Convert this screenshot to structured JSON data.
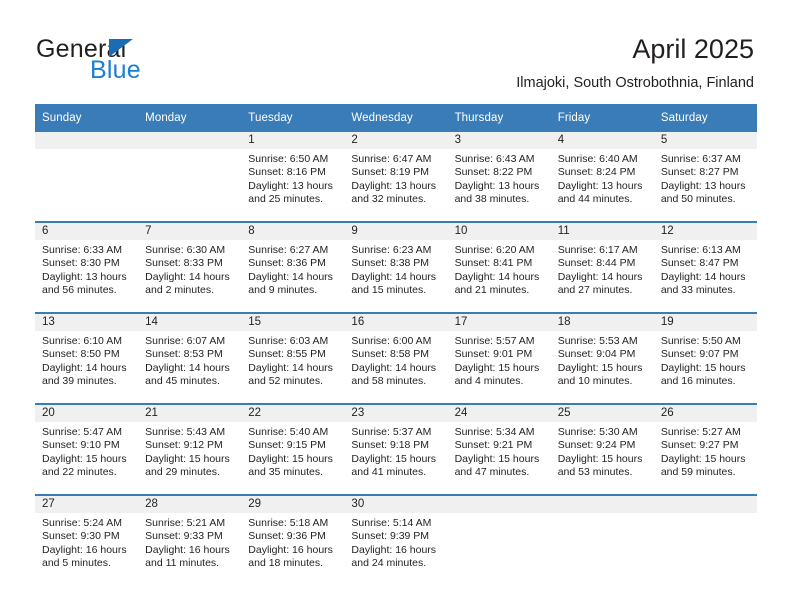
{
  "brand": {
    "name_top": "General",
    "name_bottom": "Blue",
    "accent_color": "#1b7fd4",
    "triangle_color": "#1b6cb5"
  },
  "header": {
    "title": "April 2025",
    "subtitle": "Ilmajoki, South Ostrobothnia, Finland"
  },
  "calendar": {
    "header_bg": "#3a7cb8",
    "daynum_bg": "#f0f0f0",
    "weekday_headers": [
      "Sunday",
      "Monday",
      "Tuesday",
      "Wednesday",
      "Thursday",
      "Friday",
      "Saturday"
    ],
    "weeks": [
      [
        {
          "day": "",
          "sunrise": "",
          "sunset": "",
          "daylight_line1": "",
          "daylight_line2": ""
        },
        {
          "day": "",
          "sunrise": "",
          "sunset": "",
          "daylight_line1": "",
          "daylight_line2": ""
        },
        {
          "day": "1",
          "sunrise": "Sunrise: 6:50 AM",
          "sunset": "Sunset: 8:16 PM",
          "daylight_line1": "Daylight: 13 hours",
          "daylight_line2": "and 25 minutes."
        },
        {
          "day": "2",
          "sunrise": "Sunrise: 6:47 AM",
          "sunset": "Sunset: 8:19 PM",
          "daylight_line1": "Daylight: 13 hours",
          "daylight_line2": "and 32 minutes."
        },
        {
          "day": "3",
          "sunrise": "Sunrise: 6:43 AM",
          "sunset": "Sunset: 8:22 PM",
          "daylight_line1": "Daylight: 13 hours",
          "daylight_line2": "and 38 minutes."
        },
        {
          "day": "4",
          "sunrise": "Sunrise: 6:40 AM",
          "sunset": "Sunset: 8:24 PM",
          "daylight_line1": "Daylight: 13 hours",
          "daylight_line2": "and 44 minutes."
        },
        {
          "day": "5",
          "sunrise": "Sunrise: 6:37 AM",
          "sunset": "Sunset: 8:27 PM",
          "daylight_line1": "Daylight: 13 hours",
          "daylight_line2": "and 50 minutes."
        }
      ],
      [
        {
          "day": "6",
          "sunrise": "Sunrise: 6:33 AM",
          "sunset": "Sunset: 8:30 PM",
          "daylight_line1": "Daylight: 13 hours",
          "daylight_line2": "and 56 minutes."
        },
        {
          "day": "7",
          "sunrise": "Sunrise: 6:30 AM",
          "sunset": "Sunset: 8:33 PM",
          "daylight_line1": "Daylight: 14 hours",
          "daylight_line2": "and 2 minutes."
        },
        {
          "day": "8",
          "sunrise": "Sunrise: 6:27 AM",
          "sunset": "Sunset: 8:36 PM",
          "daylight_line1": "Daylight: 14 hours",
          "daylight_line2": "and 9 minutes."
        },
        {
          "day": "9",
          "sunrise": "Sunrise: 6:23 AM",
          "sunset": "Sunset: 8:38 PM",
          "daylight_line1": "Daylight: 14 hours",
          "daylight_line2": "and 15 minutes."
        },
        {
          "day": "10",
          "sunrise": "Sunrise: 6:20 AM",
          "sunset": "Sunset: 8:41 PM",
          "daylight_line1": "Daylight: 14 hours",
          "daylight_line2": "and 21 minutes."
        },
        {
          "day": "11",
          "sunrise": "Sunrise: 6:17 AM",
          "sunset": "Sunset: 8:44 PM",
          "daylight_line1": "Daylight: 14 hours",
          "daylight_line2": "and 27 minutes."
        },
        {
          "day": "12",
          "sunrise": "Sunrise: 6:13 AM",
          "sunset": "Sunset: 8:47 PM",
          "daylight_line1": "Daylight: 14 hours",
          "daylight_line2": "and 33 minutes."
        }
      ],
      [
        {
          "day": "13",
          "sunrise": "Sunrise: 6:10 AM",
          "sunset": "Sunset: 8:50 PM",
          "daylight_line1": "Daylight: 14 hours",
          "daylight_line2": "and 39 minutes."
        },
        {
          "day": "14",
          "sunrise": "Sunrise: 6:07 AM",
          "sunset": "Sunset: 8:53 PM",
          "daylight_line1": "Daylight: 14 hours",
          "daylight_line2": "and 45 minutes."
        },
        {
          "day": "15",
          "sunrise": "Sunrise: 6:03 AM",
          "sunset": "Sunset: 8:55 PM",
          "daylight_line1": "Daylight: 14 hours",
          "daylight_line2": "and 52 minutes."
        },
        {
          "day": "16",
          "sunrise": "Sunrise: 6:00 AM",
          "sunset": "Sunset: 8:58 PM",
          "daylight_line1": "Daylight: 14 hours",
          "daylight_line2": "and 58 minutes."
        },
        {
          "day": "17",
          "sunrise": "Sunrise: 5:57 AM",
          "sunset": "Sunset: 9:01 PM",
          "daylight_line1": "Daylight: 15 hours",
          "daylight_line2": "and 4 minutes."
        },
        {
          "day": "18",
          "sunrise": "Sunrise: 5:53 AM",
          "sunset": "Sunset: 9:04 PM",
          "daylight_line1": "Daylight: 15 hours",
          "daylight_line2": "and 10 minutes."
        },
        {
          "day": "19",
          "sunrise": "Sunrise: 5:50 AM",
          "sunset": "Sunset: 9:07 PM",
          "daylight_line1": "Daylight: 15 hours",
          "daylight_line2": "and 16 minutes."
        }
      ],
      [
        {
          "day": "20",
          "sunrise": "Sunrise: 5:47 AM",
          "sunset": "Sunset: 9:10 PM",
          "daylight_line1": "Daylight: 15 hours",
          "daylight_line2": "and 22 minutes."
        },
        {
          "day": "21",
          "sunrise": "Sunrise: 5:43 AM",
          "sunset": "Sunset: 9:12 PM",
          "daylight_line1": "Daylight: 15 hours",
          "daylight_line2": "and 29 minutes."
        },
        {
          "day": "22",
          "sunrise": "Sunrise: 5:40 AM",
          "sunset": "Sunset: 9:15 PM",
          "daylight_line1": "Daylight: 15 hours",
          "daylight_line2": "and 35 minutes."
        },
        {
          "day": "23",
          "sunrise": "Sunrise: 5:37 AM",
          "sunset": "Sunset: 9:18 PM",
          "daylight_line1": "Daylight: 15 hours",
          "daylight_line2": "and 41 minutes."
        },
        {
          "day": "24",
          "sunrise": "Sunrise: 5:34 AM",
          "sunset": "Sunset: 9:21 PM",
          "daylight_line1": "Daylight: 15 hours",
          "daylight_line2": "and 47 minutes."
        },
        {
          "day": "25",
          "sunrise": "Sunrise: 5:30 AM",
          "sunset": "Sunset: 9:24 PM",
          "daylight_line1": "Daylight: 15 hours",
          "daylight_line2": "and 53 minutes."
        },
        {
          "day": "26",
          "sunrise": "Sunrise: 5:27 AM",
          "sunset": "Sunset: 9:27 PM",
          "daylight_line1": "Daylight: 15 hours",
          "daylight_line2": "and 59 minutes."
        }
      ],
      [
        {
          "day": "27",
          "sunrise": "Sunrise: 5:24 AM",
          "sunset": "Sunset: 9:30 PM",
          "daylight_line1": "Daylight: 16 hours",
          "daylight_line2": "and 5 minutes."
        },
        {
          "day": "28",
          "sunrise": "Sunrise: 5:21 AM",
          "sunset": "Sunset: 9:33 PM",
          "daylight_line1": "Daylight: 16 hours",
          "daylight_line2": "and 11 minutes."
        },
        {
          "day": "29",
          "sunrise": "Sunrise: 5:18 AM",
          "sunset": "Sunset: 9:36 PM",
          "daylight_line1": "Daylight: 16 hours",
          "daylight_line2": "and 18 minutes."
        },
        {
          "day": "30",
          "sunrise": "Sunrise: 5:14 AM",
          "sunset": "Sunset: 9:39 PM",
          "daylight_line1": "Daylight: 16 hours",
          "daylight_line2": "and 24 minutes."
        },
        {
          "day": "",
          "sunrise": "",
          "sunset": "",
          "daylight_line1": "",
          "daylight_line2": ""
        },
        {
          "day": "",
          "sunrise": "",
          "sunset": "",
          "daylight_line1": "",
          "daylight_line2": ""
        },
        {
          "day": "",
          "sunrise": "",
          "sunset": "",
          "daylight_line1": "",
          "daylight_line2": ""
        }
      ]
    ]
  }
}
